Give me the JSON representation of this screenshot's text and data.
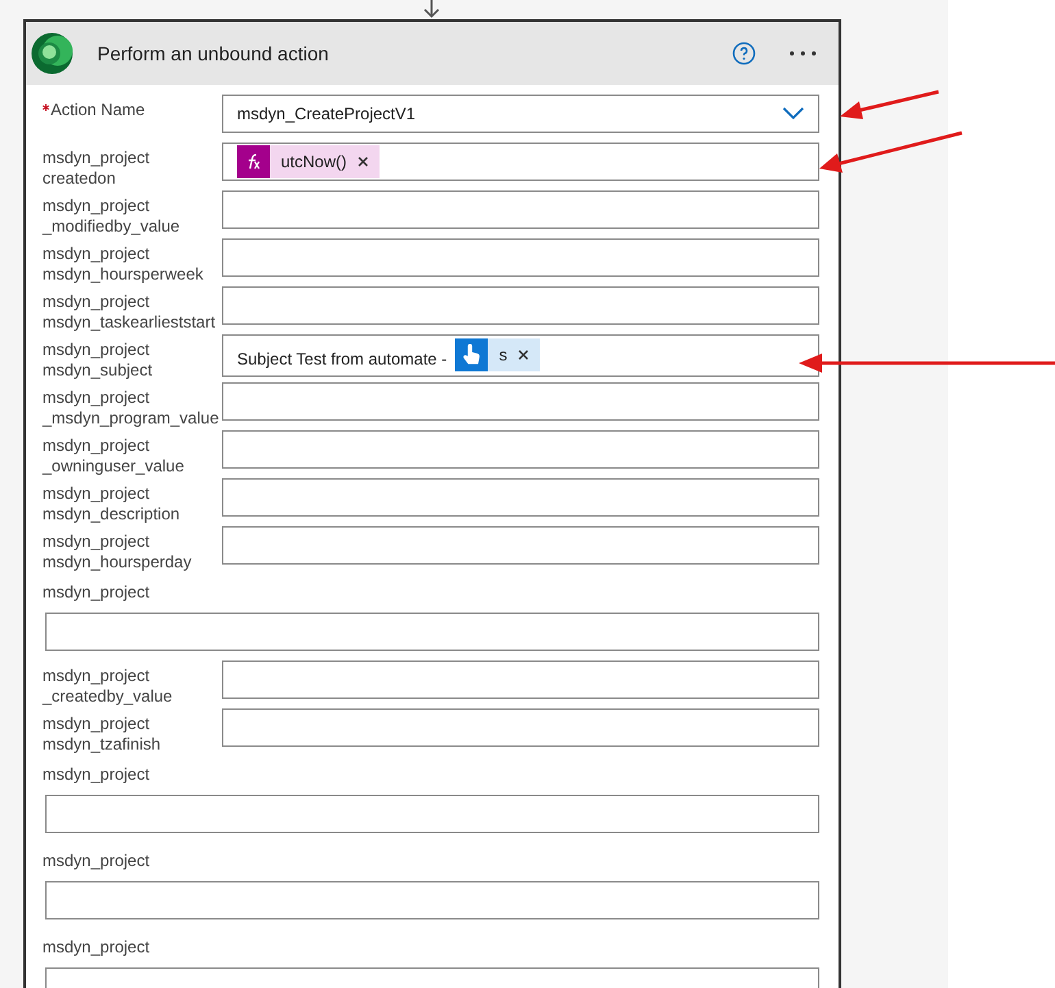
{
  "card": {
    "title": "Perform an unbound action"
  },
  "fields": [
    {
      "kind": "inline",
      "required": true,
      "label_lines": [
        "Action Name"
      ],
      "dropdown": true,
      "value": "msdyn_CreateProjectV1"
    },
    {
      "kind": "inline",
      "required": false,
      "label_lines": [
        "msdyn_project",
        "createdon"
      ],
      "dropdown": false,
      "tokens": [
        {
          "kind": "expression",
          "text": "utcNow()"
        }
      ]
    },
    {
      "kind": "inline",
      "required": false,
      "label_lines": [
        "msdyn_project",
        "_modifiedby_value"
      ],
      "dropdown": false
    },
    {
      "kind": "inline",
      "required": false,
      "label_lines": [
        "msdyn_project",
        "msdyn_hoursperweek"
      ],
      "dropdown": false
    },
    {
      "kind": "inline",
      "required": false,
      "label_lines": [
        "msdyn_project",
        "msdyn_taskearlieststart"
      ],
      "dropdown": false
    },
    {
      "kind": "inline",
      "required": false,
      "label_lines": [
        "msdyn_project",
        "msdyn_subject"
      ],
      "dropdown": false,
      "value": "Subject Test from automate -",
      "tokens": [
        {
          "kind": "trigger",
          "text": "s"
        }
      ]
    },
    {
      "kind": "inline",
      "required": false,
      "label_lines": [
        "msdyn_project",
        "_msdyn_program_value"
      ],
      "dropdown": false
    },
    {
      "kind": "inline",
      "required": false,
      "label_lines": [
        "msdyn_project",
        "_owninguser_value"
      ],
      "dropdown": false
    },
    {
      "kind": "inline",
      "required": false,
      "label_lines": [
        "msdyn_project",
        "msdyn_description"
      ],
      "dropdown": false
    },
    {
      "kind": "inline",
      "required": false,
      "label_lines": [
        "msdyn_project",
        "msdyn_hoursperday"
      ],
      "dropdown": false
    },
    {
      "kind": "stacked",
      "required": false,
      "label_lines": [
        "msdyn_project"
      ],
      "dropdown": false
    },
    {
      "kind": "inline",
      "required": false,
      "label_lines": [
        "msdyn_project",
        "_createdby_value"
      ],
      "dropdown": false
    },
    {
      "kind": "inline",
      "required": false,
      "label_lines": [
        "msdyn_project",
        "msdyn_tzafinish"
      ],
      "dropdown": false
    },
    {
      "kind": "stacked",
      "required": false,
      "label_lines": [
        "msdyn_project"
      ],
      "dropdown": false
    },
    {
      "kind": "stacked",
      "required": false,
      "label_lines": [
        "msdyn_project"
      ],
      "dropdown": false
    },
    {
      "kind": "stacked",
      "required": false,
      "label_lines": [
        "msdyn_project"
      ],
      "dropdown": false
    }
  ]
}
